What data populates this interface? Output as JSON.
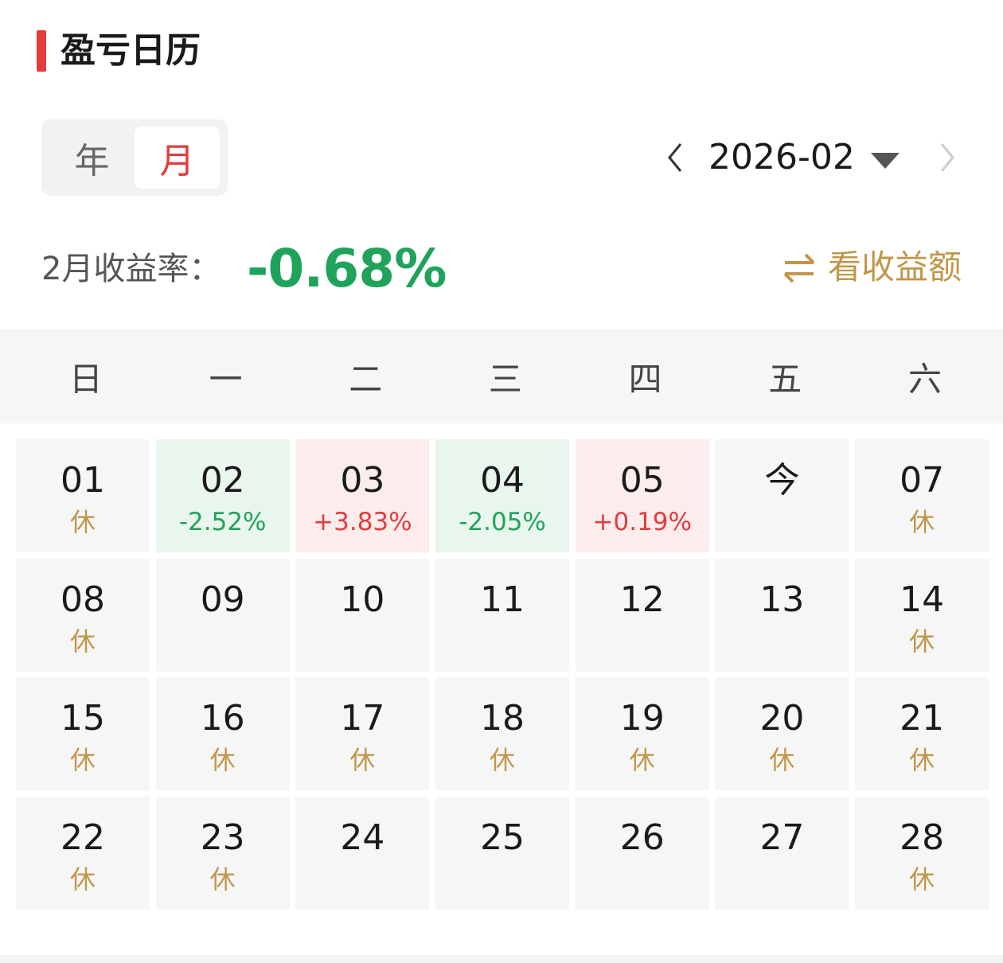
{
  "header": {
    "title": "盈亏日历"
  },
  "period_toggle": {
    "year_label": "年",
    "month_label": "月",
    "selected": "月"
  },
  "month_nav": {
    "current": "2026-02"
  },
  "summary": {
    "label": "2月收益率：",
    "value": "-0.68%",
    "toggle_label": "看收益额"
  },
  "colors": {
    "accent": "#e33c3c",
    "gain": "#e33c3c",
    "loss": "#1fa35b",
    "rest": "#c0974a"
  },
  "weekdays": [
    "日",
    "一",
    "二",
    "三",
    "四",
    "五",
    "六"
  ],
  "days": [
    {
      "num": "01",
      "sub": "休",
      "type": "rest"
    },
    {
      "num": "02",
      "sub": "-2.52%",
      "type": "neg"
    },
    {
      "num": "03",
      "sub": "+3.83%",
      "type": "pos"
    },
    {
      "num": "04",
      "sub": "-2.05%",
      "type": "neg"
    },
    {
      "num": "05",
      "sub": "+0.19%",
      "type": "pos"
    },
    {
      "num": "今",
      "sub": "",
      "type": "today"
    },
    {
      "num": "07",
      "sub": "休",
      "type": "rest"
    },
    {
      "num": "08",
      "sub": "休",
      "type": "rest"
    },
    {
      "num": "09",
      "sub": "",
      "type": "none"
    },
    {
      "num": "10",
      "sub": "",
      "type": "none"
    },
    {
      "num": "11",
      "sub": "",
      "type": "none"
    },
    {
      "num": "12",
      "sub": "",
      "type": "none"
    },
    {
      "num": "13",
      "sub": "",
      "type": "none"
    },
    {
      "num": "14",
      "sub": "休",
      "type": "rest"
    },
    {
      "num": "15",
      "sub": "休",
      "type": "rest"
    },
    {
      "num": "16",
      "sub": "休",
      "type": "rest"
    },
    {
      "num": "17",
      "sub": "休",
      "type": "rest"
    },
    {
      "num": "18",
      "sub": "休",
      "type": "rest"
    },
    {
      "num": "19",
      "sub": "休",
      "type": "rest"
    },
    {
      "num": "20",
      "sub": "休",
      "type": "rest"
    },
    {
      "num": "21",
      "sub": "休",
      "type": "rest"
    },
    {
      "num": "22",
      "sub": "休",
      "type": "rest"
    },
    {
      "num": "23",
      "sub": "休",
      "type": "rest"
    },
    {
      "num": "24",
      "sub": "",
      "type": "none"
    },
    {
      "num": "25",
      "sub": "",
      "type": "none"
    },
    {
      "num": "26",
      "sub": "",
      "type": "none"
    },
    {
      "num": "27",
      "sub": "",
      "type": "none"
    },
    {
      "num": "28",
      "sub": "休",
      "type": "rest"
    }
  ]
}
